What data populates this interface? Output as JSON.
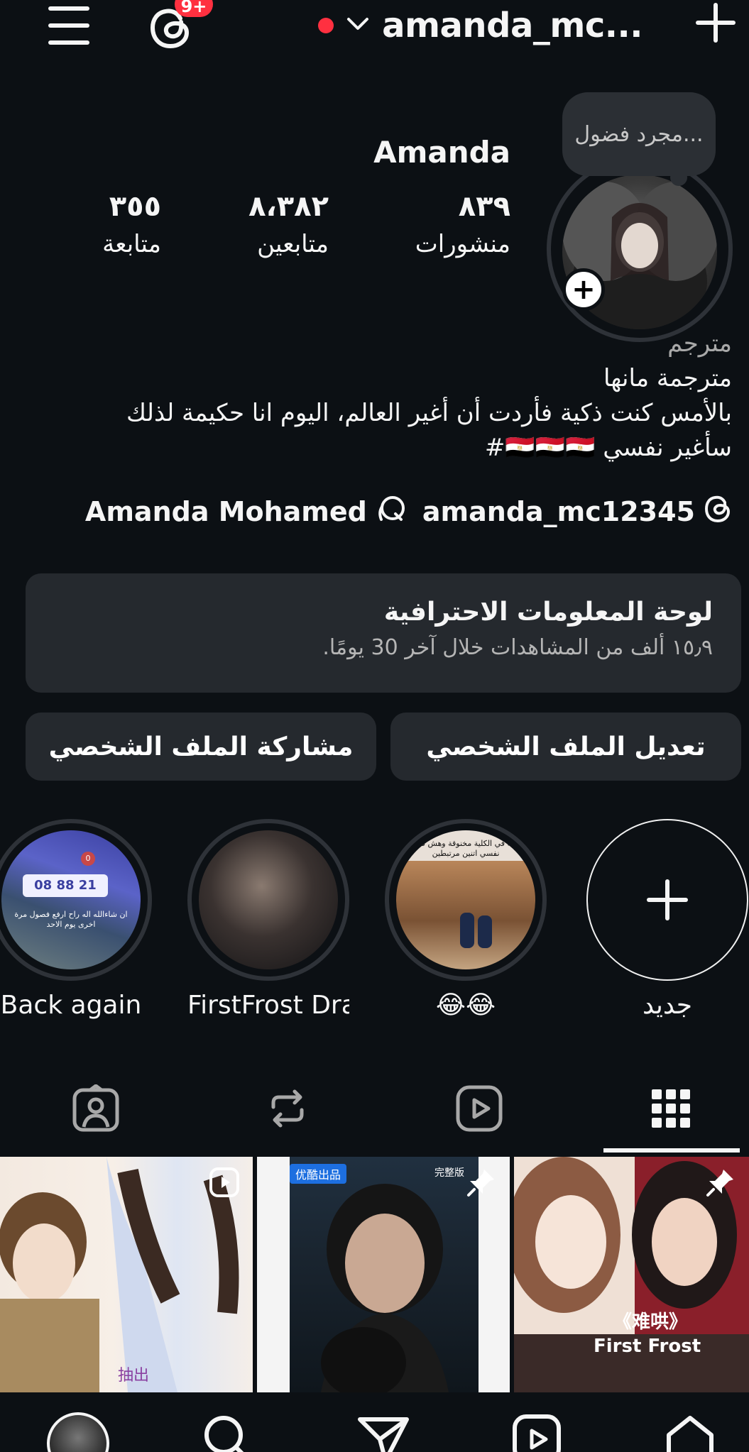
{
  "header": {
    "username": "amanda_mc...",
    "notification_badge": "9+"
  },
  "profile": {
    "note": "مجرد فضول...",
    "display_name": "Amanda",
    "stats": [
      {
        "value": "٨٣٩",
        "label": "منشورات"
      },
      {
        "value": "٨،٣٨٢",
        "label": "متابعين"
      },
      {
        "value": "٣٥٥",
        "label": "متابعة"
      }
    ],
    "bio": {
      "category": "مترجم",
      "line1": "مترجمة مانها",
      "line2": "بالأمس كنت ذكية فأردت أن أغير العالم، اليوم انا حكيمة لذلك",
      "line3": "سأغير نفسي 🇪🇬🇪🇬🇪🇬#"
    },
    "links": {
      "threads_username": "amanda_mc12345",
      "facebook_name": "Amanda Mohamed"
    }
  },
  "dashboard": {
    "title": "لوحة المعلومات الاحترافية",
    "subtitle": "١٥٫٩ ألف من المشاهدات خلال آخر 30 يومًا."
  },
  "buttons": {
    "edit_profile": "تعديل الملف الشخصي",
    "share_profile": "مشاركة الملف الشخصي"
  },
  "highlights": [
    {
      "label": "جديد"
    },
    {
      "label": "😂😂"
    },
    {
      "label": "FirstFrost Dra..."
    },
    {
      "label": "Back again"
    }
  ],
  "highlight_story_text": {
    "h1_caption": "واقفة في الكلية مخنوقة وهش طايقة نفسي اتنين مرتبطين",
    "h3_caption": "ان شاءالله اله راح ارفع فصول مرة اخرى يوم الاحد",
    "h3_counter": "08 88 21",
    "h3_unit": "0"
  },
  "grid": [
    {
      "type": "reel",
      "overlay_text": "抽出"
    },
    {
      "type": "pinned",
      "overlay_text": "优酷出品",
      "tag": "完整版"
    },
    {
      "type": "pinned",
      "overlay_text": "《难哄》",
      "overlay_text2": "First Frost"
    }
  ]
}
